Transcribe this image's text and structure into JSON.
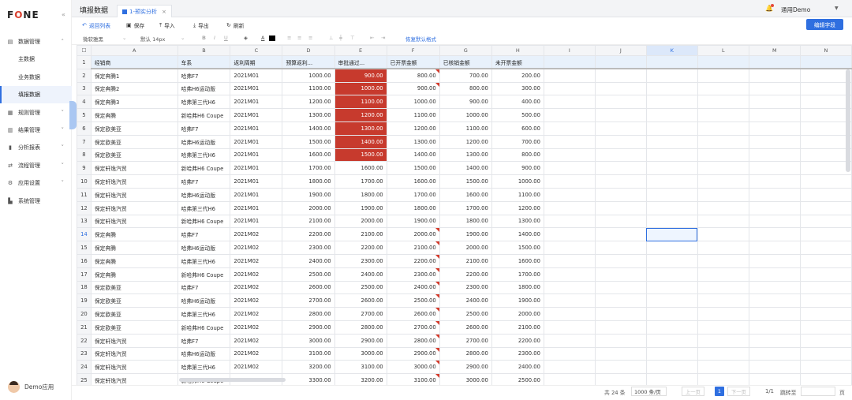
{
  "app": {
    "logo_f": "F",
    "logo_o": "O",
    "logo_ne": "NE"
  },
  "sidebar": {
    "items": [
      {
        "label": "数据管理",
        "icon": "▤"
      },
      {
        "label": "主数据"
      },
      {
        "label": "业务数据"
      },
      {
        "label": "填报数据"
      },
      {
        "label": "规则管理",
        "icon": "▦"
      },
      {
        "label": "结果管理",
        "icon": "▥"
      },
      {
        "label": "分析报表",
        "icon": "▮"
      },
      {
        "label": "流程管理",
        "icon": "⇄"
      },
      {
        "label": "应用设置",
        "icon": "⚙"
      },
      {
        "label": "系统管理",
        "icon": "▙"
      }
    ],
    "user_name": "Demo应用"
  },
  "header": {
    "page_title": "填报数据",
    "tab_label": "1-预实分析",
    "user_menu": "通用Demo"
  },
  "toolbar": {
    "back": "返回列表",
    "save": "保存",
    "import": "导入",
    "export": "导出",
    "refresh": "刷新",
    "edit_field": "编辑字段"
  },
  "format_bar": {
    "font": "微软雅黑",
    "font_size": "默认 14px",
    "bold": "B",
    "italic": "I",
    "underline": "U",
    "font_color": "A",
    "restore": "恢复默认格式"
  },
  "grid": {
    "column_letters": [
      "A",
      "B",
      "C",
      "D",
      "E",
      "F",
      "G",
      "H",
      "I",
      "J",
      "K",
      "L",
      "M",
      "N"
    ],
    "headers": [
      "经销商",
      "车系",
      "返利周期",
      "预算返利...",
      "审批通过...",
      "已开票金额",
      "已核销金额",
      "未开票金额"
    ],
    "rows": [
      [
        "保定奔腾1",
        "哈弗F7",
        "2021M01",
        "1000.00",
        "900.00",
        "800.00",
        "700.00",
        "200.00"
      ],
      [
        "保定奔腾2",
        "哈弗H6运动版",
        "2021M01",
        "1100.00",
        "1000.00",
        "900.00",
        "800.00",
        "300.00"
      ],
      [
        "保定奔腾3",
        "哈弗第三代H6",
        "2021M01",
        "1200.00",
        "1100.00",
        "1000.00",
        "900.00",
        "400.00"
      ],
      [
        "保定奔腾",
        "新哈弗H6 Coupe",
        "2021M01",
        "1300.00",
        "1200.00",
        "1100.00",
        "1000.00",
        "500.00"
      ],
      [
        "保定欧美亚",
        "哈弗F7",
        "2021M01",
        "1400.00",
        "1300.00",
        "1200.00",
        "1100.00",
        "600.00"
      ],
      [
        "保定欧美亚",
        "哈弗H6运动版",
        "2021M01",
        "1500.00",
        "1400.00",
        "1300.00",
        "1200.00",
        "700.00"
      ],
      [
        "保定欧美亚",
        "哈弗第三代H6",
        "2021M01",
        "1600.00",
        "1500.00",
        "1400.00",
        "1300.00",
        "800.00"
      ],
      [
        "保定轩逸汽贸",
        "新哈弗H6 Coupe",
        "2021M01",
        "1700.00",
        "1600.00",
        "1500.00",
        "1400.00",
        "900.00"
      ],
      [
        "保定轩逸汽贸",
        "哈弗F7",
        "2021M01",
        "1800.00",
        "1700.00",
        "1600.00",
        "1500.00",
        "1000.00"
      ],
      [
        "保定轩逸汽贸",
        "哈弗H6运动版",
        "2021M01",
        "1900.00",
        "1800.00",
        "1700.00",
        "1600.00",
        "1100.00"
      ],
      [
        "保定轩逸汽贸",
        "哈弗第三代H6",
        "2021M01",
        "2000.00",
        "1900.00",
        "1800.00",
        "1700.00",
        "1200.00"
      ],
      [
        "保定轩逸汽贸",
        "新哈弗H6 Coupe",
        "2021M01",
        "2100.00",
        "2000.00",
        "1900.00",
        "1800.00",
        "1300.00"
      ],
      [
        "保定奔腾",
        "哈弗F7",
        "2021M02",
        "2200.00",
        "2100.00",
        "2000.00",
        "1900.00",
        "1400.00"
      ],
      [
        "保定奔腾",
        "哈弗H6运动版",
        "2021M02",
        "2300.00",
        "2200.00",
        "2100.00",
        "2000.00",
        "1500.00"
      ],
      [
        "保定奔腾",
        "哈弗第三代H6",
        "2021M02",
        "2400.00",
        "2300.00",
        "2200.00",
        "2100.00",
        "1600.00"
      ],
      [
        "保定奔腾",
        "新哈弗H6 Coupe",
        "2021M02",
        "2500.00",
        "2400.00",
        "2300.00",
        "2200.00",
        "1700.00"
      ],
      [
        "保定欧美亚",
        "哈弗F7",
        "2021M02",
        "2600.00",
        "2500.00",
        "2400.00",
        "2300.00",
        "1800.00"
      ],
      [
        "保定欧美亚",
        "哈弗H6运动版",
        "2021M02",
        "2700.00",
        "2600.00",
        "2500.00",
        "2400.00",
        "1900.00"
      ],
      [
        "保定欧美亚",
        "哈弗第三代H6",
        "2021M02",
        "2800.00",
        "2700.00",
        "2600.00",
        "2500.00",
        "2000.00"
      ],
      [
        "保定欧美亚",
        "新哈弗H6 Coupe",
        "2021M02",
        "2900.00",
        "2800.00",
        "2700.00",
        "2600.00",
        "2100.00"
      ],
      [
        "保定轩逸汽贸",
        "哈弗F7",
        "2021M02",
        "3000.00",
        "2900.00",
        "2800.00",
        "2700.00",
        "2200.00"
      ],
      [
        "保定轩逸汽贸",
        "哈弗H6运动版",
        "2021M02",
        "3100.00",
        "3000.00",
        "2900.00",
        "2800.00",
        "2300.00"
      ],
      [
        "保定轩逸汽贸",
        "哈弗第三代H6",
        "2021M02",
        "3200.00",
        "3100.00",
        "3000.00",
        "2900.00",
        "2400.00"
      ],
      [
        "保定轩逸汽贸",
        "新哈弗H6 Coupe",
        "2021M02",
        "3300.00",
        "3200.00",
        "3100.00",
        "3000.00",
        "2500.00"
      ]
    ],
    "red_rows": [
      1,
      2,
      3,
      4,
      5,
      6,
      7
    ],
    "marked_rows": [
      1,
      2,
      13,
      14,
      15,
      16,
      17,
      18,
      19,
      20,
      21,
      22,
      23,
      24
    ],
    "selected_cell": "K14",
    "selected_row": 14
  },
  "pagination": {
    "total": "共 24 条",
    "page_size": "1000 条/页",
    "prev": "上一页",
    "page": "1",
    "next": "下一页",
    "page_count": "1/1",
    "goto": "跳转至",
    "page_unit": "页"
  },
  "colors": {
    "accent": "#2f6fe0",
    "highlight_red": "#c73a2d"
  }
}
